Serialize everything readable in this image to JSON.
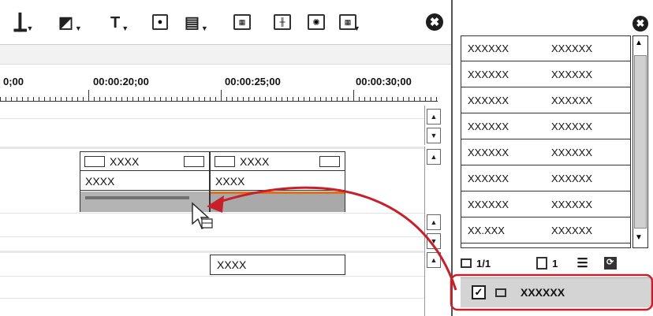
{
  "toolbar": {
    "icons": [
      "text-cursor-icon",
      "crop-icon",
      "title-icon",
      "voiceover-icon",
      "marker-icon",
      "grid-icon",
      "mixer-icon",
      "effect-icon",
      "monitor-icon"
    ],
    "close_glyph": "✖"
  },
  "ruler": {
    "timecodes": [
      "0;00",
      "00:00:20;00",
      "00:00:25;00",
      "00:00:30;00"
    ]
  },
  "timeline": {
    "clip1_title": "XXXX",
    "clip2_title": "XXXX",
    "clip1_label": "XXXX",
    "clip2_label": "XXXX",
    "clip3_label": "XXXX",
    "clip_line_color": "#e07020",
    "drag_arrow_color": "#c8202a"
  },
  "bin": {
    "close_glyph": "✖",
    "rows": [
      [
        "XXXXXX",
        "XXXXXX"
      ],
      [
        "XXXXXX",
        "XXXXXX"
      ],
      [
        "XXXXXX",
        "XXXXXX"
      ],
      [
        "XXXXXX",
        "XXXXXX"
      ],
      [
        "XXXXXX",
        "XXXXXX"
      ],
      [
        "XXXXXX",
        "XXXXXX"
      ],
      [
        "XXXXXX",
        "XXXXXX"
      ],
      [
        "XX.XXX",
        "XXXXXX"
      ]
    ],
    "page_indicator": "1/1",
    "count": "1",
    "selected_item": "XXXXXX",
    "highlight_color": "#c8202a"
  }
}
